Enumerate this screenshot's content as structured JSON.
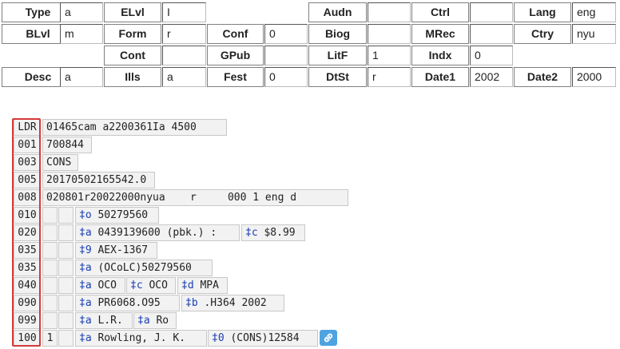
{
  "fixed_fields": {
    "type": {
      "label": "Type",
      "value": "a"
    },
    "elvl": {
      "label": "ELvl",
      "value": "I"
    },
    "audn": {
      "label": "Audn",
      "value": ""
    },
    "ctrl": {
      "label": "Ctrl",
      "value": ""
    },
    "lang": {
      "label": "Lang",
      "value": "eng"
    },
    "blvl": {
      "label": "BLvl",
      "value": "m"
    },
    "form": {
      "label": "Form",
      "value": "r"
    },
    "conf": {
      "label": "Conf",
      "value": "0"
    },
    "biog": {
      "label": "Biog",
      "value": ""
    },
    "mrec": {
      "label": "MRec",
      "value": ""
    },
    "ctry": {
      "label": "Ctry",
      "value": "nyu"
    },
    "cont": {
      "label": "Cont",
      "value": ""
    },
    "gpub": {
      "label": "GPub",
      "value": ""
    },
    "litf": {
      "label": "LitF",
      "value": "1"
    },
    "indx": {
      "label": "Indx",
      "value": "0"
    },
    "desc": {
      "label": "Desc",
      "value": "a"
    },
    "ills": {
      "label": "Ills",
      "value": "a"
    },
    "fest": {
      "label": "Fest",
      "value": "0"
    },
    "dtst": {
      "label": "DtSt",
      "value": "r"
    },
    "date1": {
      "label": "Date1",
      "value": "2002"
    },
    "date2": {
      "label": "Date2",
      "value": "2000"
    }
  },
  "record": {
    "ldr": {
      "tag": "LDR",
      "value": "01465cam a2200361Ia 4500"
    },
    "f001": {
      "tag": "001",
      "value": "700844"
    },
    "f003": {
      "tag": "003",
      "value": "CONS"
    },
    "f005": {
      "tag": "005",
      "value": "20170502165542.0"
    },
    "f008": {
      "tag": "008",
      "value": "020801r20022000nyua    r     000 1 eng d"
    },
    "f010": {
      "tag": "010",
      "ind1": "",
      "ind2": "",
      "subfields": [
        {
          "code": "‡o",
          "text": " 50279560"
        }
      ]
    },
    "f020": {
      "tag": "020",
      "ind1": "",
      "ind2": "",
      "subfields": [
        {
          "code": "‡a",
          "text": " 0439139600 (pbk.) :"
        },
        {
          "code": "‡c",
          "text": " $8.99"
        }
      ]
    },
    "f035a": {
      "tag": "035",
      "ind1": "",
      "ind2": "",
      "subfields": [
        {
          "code": "‡9",
          "text": " AEX-1367"
        }
      ]
    },
    "f035b": {
      "tag": "035",
      "ind1": "",
      "ind2": "",
      "subfields": [
        {
          "code": "‡a",
          "text": " (OCoLC)50279560"
        }
      ]
    },
    "f040": {
      "tag": "040",
      "ind1": "",
      "ind2": "",
      "subfields": [
        {
          "code": "‡a",
          "text": " OCO"
        },
        {
          "code": "‡c",
          "text": " OCO"
        },
        {
          "code": "‡d",
          "text": " MPA"
        }
      ]
    },
    "f090": {
      "tag": "090",
      "ind1": "",
      "ind2": "",
      "subfields": [
        {
          "code": "‡a",
          "text": " PR6068.O95"
        },
        {
          "code": "‡b",
          "text": " .H364 2002"
        }
      ]
    },
    "f099": {
      "tag": "099",
      "ind1": "",
      "ind2": "",
      "subfields": [
        {
          "code": "‡a",
          "text": " L.R."
        },
        {
          "code": "‡a",
          "text": " Ro"
        }
      ]
    },
    "f100": {
      "tag": "100",
      "ind1": "1",
      "ind2": "",
      "subfields": [
        {
          "code": "‡a",
          "text": " Rowling, J. K."
        },
        {
          "code": "‡0",
          "text": " (CONS)12584"
        }
      ]
    }
  },
  "icons": {
    "link": "link-icon"
  }
}
